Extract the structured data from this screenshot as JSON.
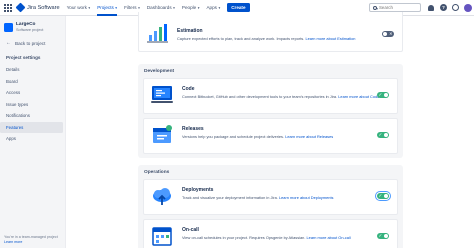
{
  "topnav": {
    "logo_text": "Jira Software",
    "items": [
      {
        "label": "Your work",
        "caret": "▾"
      },
      {
        "label": "Projects",
        "caret": "▾"
      },
      {
        "label": "Filters",
        "caret": "▾"
      },
      {
        "label": "Dashboards",
        "caret": "▾"
      },
      {
        "label": "People",
        "caret": "▾"
      },
      {
        "label": "Apps",
        "caret": "▾"
      }
    ],
    "active_item": "Projects",
    "create_label": "Create",
    "search_placeholder": "Search",
    "help_glyph": "?"
  },
  "sidebar": {
    "project_name": "LargeCo",
    "project_type": "Software project",
    "back_arrow": "←",
    "back_label": "Back to project",
    "section_title": "Project settings",
    "items": [
      {
        "label": "Details"
      },
      {
        "label": "Board"
      },
      {
        "label": "Access"
      },
      {
        "label": "Issue types"
      },
      {
        "label": "Notifications"
      },
      {
        "label": "Features"
      },
      {
        "label": "Apps"
      }
    ],
    "active_item": "Features",
    "footer_text": "You're in a team-managed project",
    "footer_link": "Learn more"
  },
  "main": {
    "top_feature": {
      "name": "Estimation",
      "description": "Capture expected efforts to plan, track and analyze work.",
      "extra": "Impacts reports.",
      "link": "Learn more about Estimation",
      "state": "off"
    },
    "sections": [
      {
        "title": "Development",
        "features": [
          {
            "name": "Code",
            "description": "Connect Bitbucket, GitHub and other development tools to your team's repositories in Jira.",
            "link": "Learn more about Code",
            "state": "on"
          },
          {
            "name": "Releases",
            "description": "Versions help you package and schedule project deliveries.",
            "link": "Learn more about Releases",
            "state": "on"
          }
        ]
      },
      {
        "title": "Operations",
        "features": [
          {
            "name": "Deployments",
            "description": "Track and visualize your deployment information in Jira.",
            "link": "Learn more about Deployments",
            "state": "on"
          },
          {
            "name": "On-call",
            "description": "View on-call schedules in your project. Requires Opsgenie by Atlassian.",
            "link": "Learn more about On-call",
            "state": "on"
          }
        ]
      }
    ]
  },
  "colors": {
    "primary": "#0052cc",
    "toggle_on": "#36b37e",
    "toggle_off": "#505f79",
    "sidebar_bg": "#f4f5f7"
  }
}
